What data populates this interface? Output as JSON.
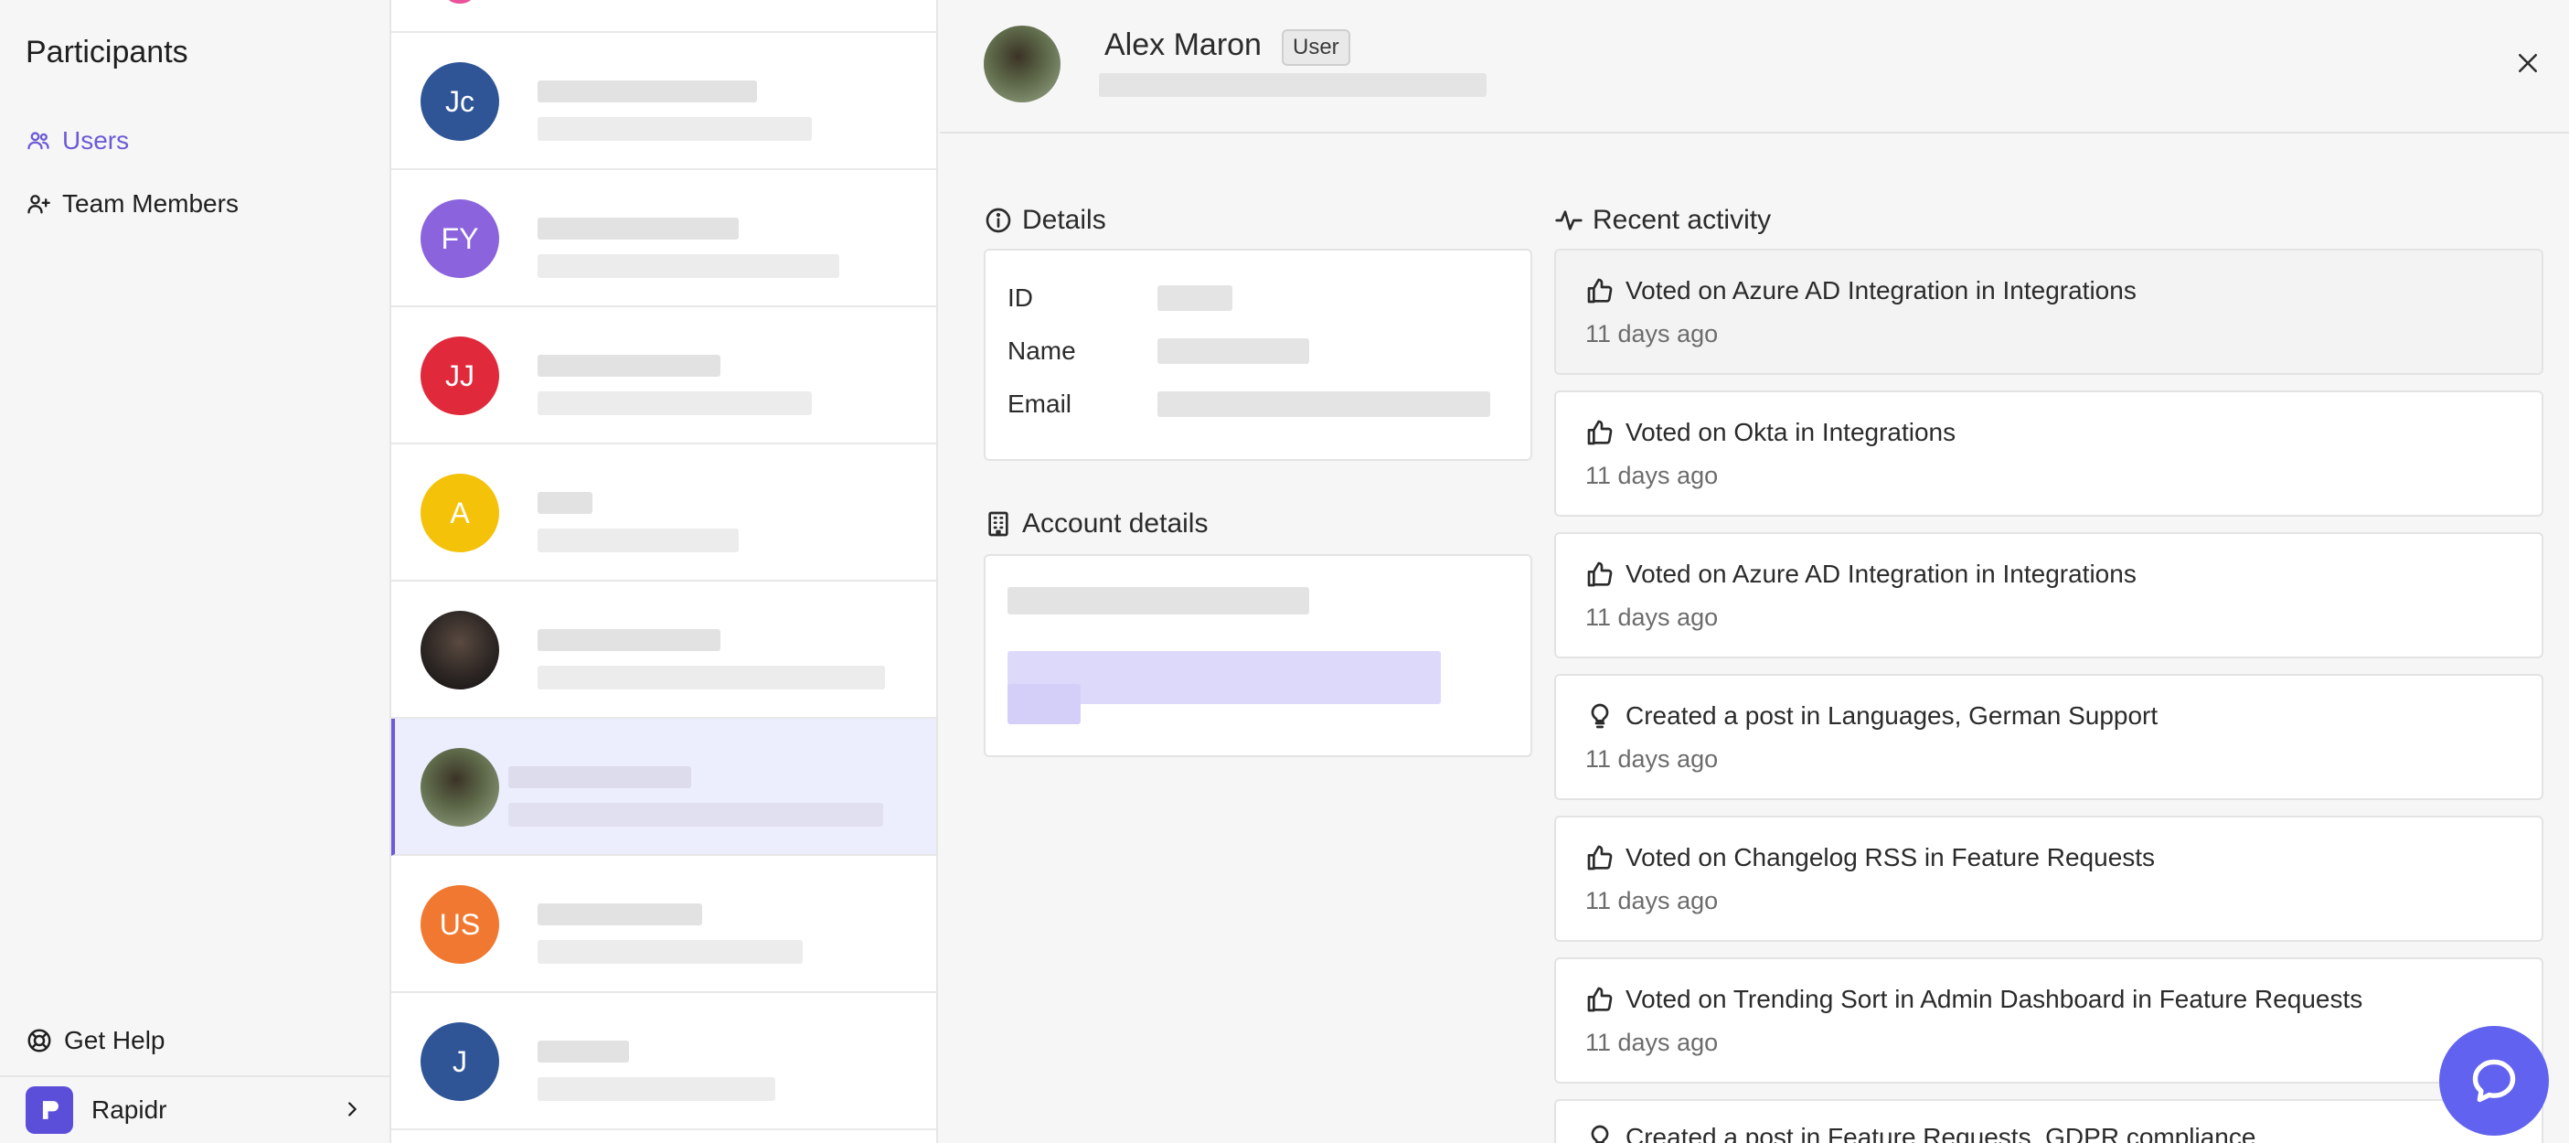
{
  "nav": {
    "title": "Participants",
    "items": [
      {
        "label": "Users",
        "icon": "users-icon"
      },
      {
        "label": "Team Members",
        "icon": "user-plus-icon"
      }
    ],
    "help_label": "Get Help",
    "org_name": "Rapidr"
  },
  "list": {
    "rows": [
      {
        "initials": "Jc",
        "color": "#2f5597"
      },
      {
        "initials": "FY",
        "color": "#8b63dd"
      },
      {
        "initials": "JJ",
        "color": "#e0293b"
      },
      {
        "initials": "A",
        "color": "#f5c20a"
      },
      {
        "initials": "",
        "color": "#2a2422"
      },
      {
        "initials": "",
        "color": "#4a5a3b"
      },
      {
        "initials": "US",
        "color": "#f07830"
      },
      {
        "initials": "J",
        "color": "#2f5597"
      }
    ]
  },
  "user": {
    "name": "Alex Maron",
    "badge": "User"
  },
  "details": {
    "title": "Details",
    "fields": [
      {
        "label": "ID"
      },
      {
        "label": "Name"
      },
      {
        "label": "Email"
      }
    ]
  },
  "account": {
    "title": "Account details"
  },
  "activity": {
    "title": "Recent activity",
    "items": [
      {
        "text": "Voted on Azure AD Integration in Integrations",
        "time": "11 days ago",
        "icon": "thumbs-up-icon"
      },
      {
        "text": "Voted on Okta in Integrations",
        "time": "11 days ago",
        "icon": "thumbs-up-icon"
      },
      {
        "text": "Voted on Azure AD Integration in Integrations",
        "time": "11 days ago",
        "icon": "thumbs-up-icon"
      },
      {
        "text": "Created a post in Languages, German Support",
        "time": "11 days ago",
        "icon": "lightbulb-icon"
      },
      {
        "text": "Voted on Changelog RSS in Feature Requests",
        "time": "11 days ago",
        "icon": "thumbs-up-icon"
      },
      {
        "text": "Voted on Trending Sort in Admin Dashboard in Feature Requests",
        "time": "11 days ago",
        "icon": "thumbs-up-icon"
      },
      {
        "text": "Created a post in Feature Requests, GDPR compliance",
        "time": "",
        "icon": "lightbulb-icon"
      }
    ]
  },
  "colors": {
    "accent": "#6b5bd8",
    "chat": "#6262f0"
  }
}
